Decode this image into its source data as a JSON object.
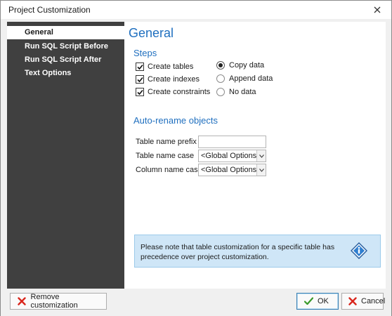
{
  "window": {
    "title": "Project Customization"
  },
  "sidebar": {
    "items": [
      {
        "label": "General",
        "active": true
      },
      {
        "label": "Run SQL Script Before",
        "active": false
      },
      {
        "label": "Run SQL Script After",
        "active": false
      },
      {
        "label": "Text Options",
        "active": false
      }
    ]
  },
  "main": {
    "heading": "General",
    "steps": {
      "heading": "Steps",
      "checkboxes": [
        {
          "label": "Create tables",
          "checked": true
        },
        {
          "label": "Create indexes",
          "checked": true
        },
        {
          "label": "Create constraints",
          "checked": true
        }
      ],
      "radios": [
        {
          "label": "Copy data",
          "selected": true
        },
        {
          "label": "Append data",
          "selected": false
        },
        {
          "label": "No data",
          "selected": false
        }
      ]
    },
    "rename": {
      "heading": "Auto-rename objects",
      "prefix_label": "Table name prefix",
      "prefix_value": "",
      "table_case_label": "Table name case",
      "table_case_value": "<Global Options>",
      "column_case_label": "Column name case",
      "column_case_value": "<Global Options>"
    },
    "note": "Please note that table customization for a specific table has precedence over project customization."
  },
  "footer": {
    "remove_label": "Remove customization",
    "ok_label": "OK",
    "cancel_label": "Cancel"
  },
  "icons": {
    "close": "close-icon",
    "check": "checkmark-icon",
    "info": "info-diamond-icon",
    "remove": "red-x-icon",
    "ok": "green-check-icon",
    "cancel": "red-x-icon"
  },
  "colors": {
    "accent": "#1f6fbf",
    "sidebar_bg": "#404040",
    "note_bg": "#cfe6f7",
    "red": "#d9261c",
    "green": "#3a9a2b"
  }
}
